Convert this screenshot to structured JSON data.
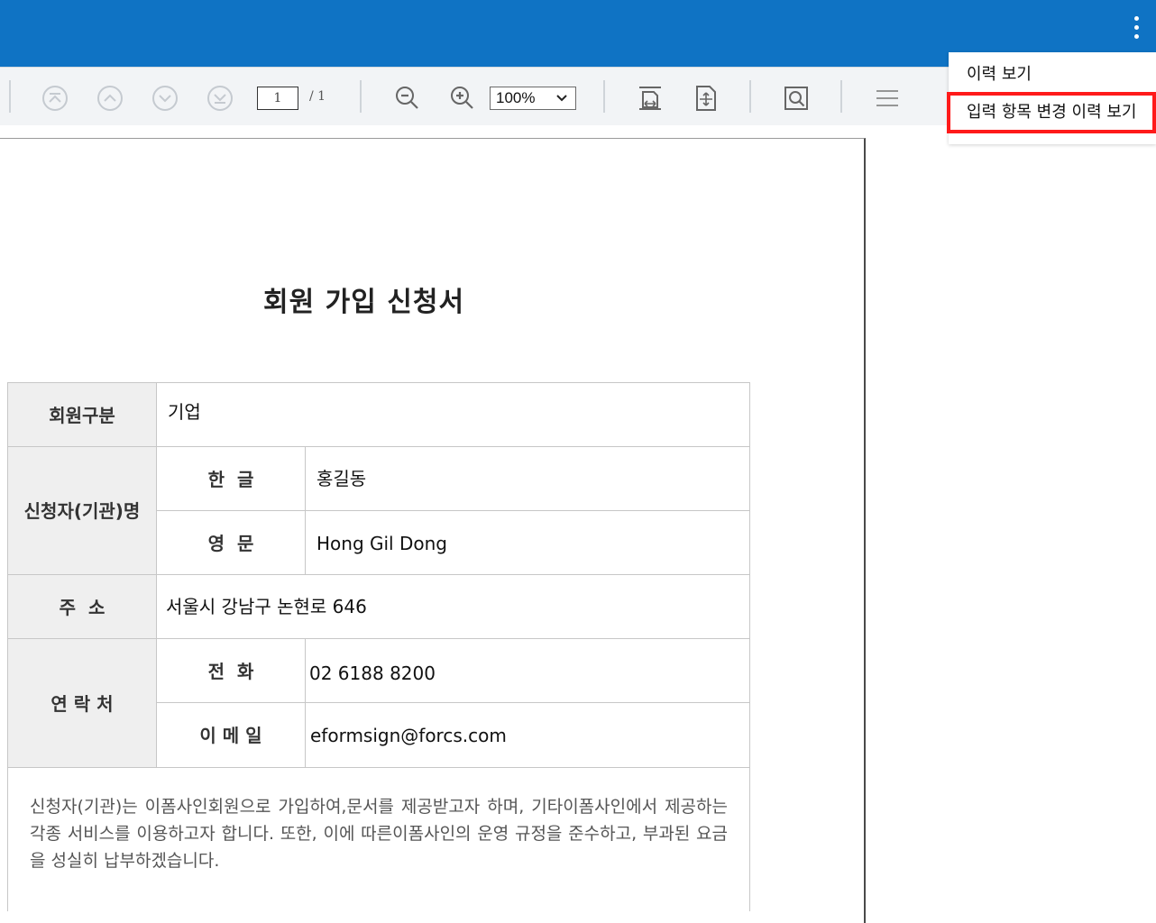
{
  "toolbar": {
    "page_current": "1",
    "page_total": "/ 1",
    "zoom": "100%",
    "icons": [
      "first-page-icon",
      "prev-page-icon",
      "next-page-icon",
      "last-page-icon",
      "zoom-out-icon",
      "zoom-in-icon",
      "fit-width-icon",
      "fit-page-icon",
      "search-icon",
      "menu-icon"
    ]
  },
  "menu": {
    "items": [
      {
        "label": "이력 보기"
      },
      {
        "label": "입력 항목 변경 이력 보기",
        "highlighted": true
      }
    ]
  },
  "document": {
    "title": "회원 가입 신청서",
    "rows": {
      "member_type": {
        "label": "회원구분",
        "value": "기업"
      },
      "applicant": {
        "label": "신청자(기관)명",
        "korean": {
          "label": "한  글",
          "value": "홍길동"
        },
        "english": {
          "label": "영  문",
          "value": "Hong Gil Dong"
        }
      },
      "address": {
        "label": "주  소",
        "value": "서울시 강남구 논현로 646"
      },
      "contact": {
        "label": "연 락 처",
        "phone": {
          "label": "전  화",
          "value": "02 6188 8200"
        },
        "email": {
          "label": "이 메 일",
          "value": "eformsign@forcs.com"
        }
      }
    },
    "notice": "신청자(기관)는 이폼사인회원으로 가입하여,문서를 제공받고자 하며, 기타이폼사인에서 제공하는 각종 서비스를 이용하고자 합니다. 또한, 이에 따른이폼사인의 운영 규정을 준수하고, 부과된 요금을 성실히 납부하겠습니다."
  },
  "colors": {
    "header_bg": "#0f73c4",
    "toolbar_bg": "#f2f4f6",
    "highlight_border": "#ff1a1a",
    "label_bg": "#efefef"
  }
}
